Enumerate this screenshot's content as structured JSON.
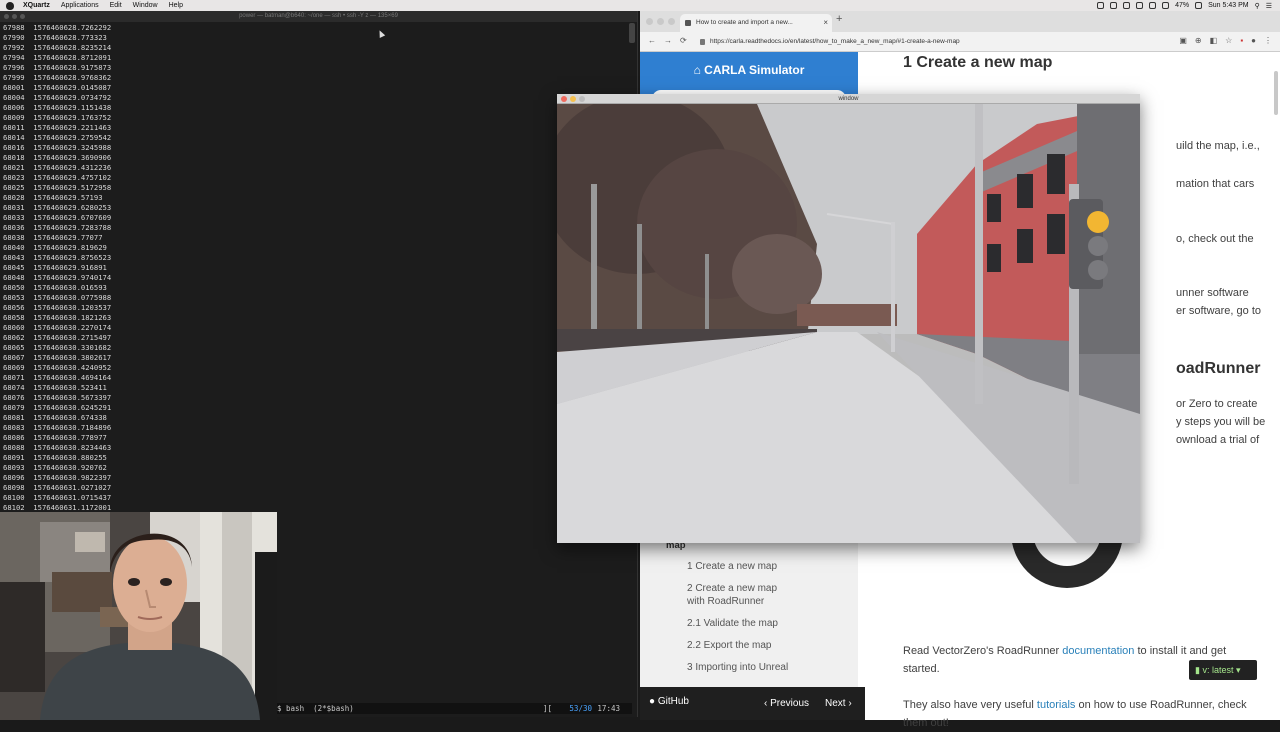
{
  "menubar": {
    "app": "XQuartz",
    "items": [
      "Applications",
      "Edit",
      "Window",
      "Help"
    ],
    "battery": "47%",
    "clock": "Sun 5:43 PM"
  },
  "terminal": {
    "title": "power — batman@b640: ~/one — ssh • ssh -Y z — 135×69",
    "lines": [
      "67988  1576460628.7262292",
      "67990  1576460628.773323",
      "67992  1576460628.8235214",
      "67994  1576460628.8712091",
      "67996  1576460628.9175873",
      "67999  1576460628.9768362",
      "68001  1576460629.0145087",
      "68004  1576460629.0734792",
      "68006  1576460629.1151438",
      "68009  1576460629.1763752",
      "68011  1576460629.2211463",
      "68014  1576460629.2759542",
      "68016  1576460629.3245988",
      "68018  1576460629.3690906",
      "68021  1576460629.4312236",
      "68023  1576460629.4757102",
      "68025  1576460629.5172958",
      "68028  1576460629.57193",
      "68031  1576460629.6280253",
      "68033  1576460629.6707609",
      "68036  1576460629.7283788",
      "68038  1576460629.77077",
      "68040  1576460629.819629",
      "68043  1576460629.8756523",
      "68045  1576460629.916891",
      "68048  1576460629.9740174",
      "68050  1576460630.016593",
      "68053  1576460630.0775988",
      "68056  1576460630.1203537",
      "68058  1576460630.1821263",
      "68060  1576460630.2270174",
      "68062  1576460630.2715497",
      "68065  1576460630.3301682",
      "68067  1576460630.3802617",
      "68069  1576460630.4240952",
      "68071  1576460630.4694164",
      "68074  1576460630.523411",
      "68076  1576460630.5673397",
      "68079  1576460630.6245291",
      "68081  1576460630.674338",
      "68083  1576460630.7184896",
      "68086  1576460630.778977",
      "68088  1576460630.8234463",
      "68091  1576460630.880255",
      "68093  1576460630.920762",
      "68096  1576460630.9822397",
      "68098  1576460631.0271027",
      "68100  1576460631.0715437",
      "68102  1576460631.1172001"
    ],
    "status_left": "$ bash  (2*$bash)",
    "status_bracket": "][",
    "status_pct": "53/30",
    "status_time": "17:43"
  },
  "browser": {
    "tab_title": "How to create and import a new...",
    "url": "https://carla.readthedocs.io/en/latest/how_to_make_a_new_map/#1-create-a-new-map",
    "sidebar": {
      "brand": "CARLA Simulator",
      "section": "map",
      "toc": [
        "1 Create a new map",
        "2 Create a new map with RoadRunner",
        "2.1 Validate the map",
        "2.2 Export the map",
        "3 Importing into Unreal"
      ],
      "github": "GitHub",
      "previous": "Previous",
      "next": "Next"
    },
    "content": {
      "heading": "1 Create a new map",
      "fragments": [
        "uild the map, i.e.,",
        "mation that cars",
        "o, check out the",
        "unner software",
        "er software, go to",
        "or Zero to create",
        "y steps you will be",
        "ownload a trial of"
      ],
      "heading2_fragment": "oadRunner",
      "para1_pre": "Read VectorZero's RoadRunner ",
      "para1_link": "documentation",
      "para1_post": " to install it and get started.",
      "para2_pre": "They also have very useful ",
      "para2_link": "tutorials",
      "para2_post": " on how to use RoadRunner, check them out!"
    },
    "version_badge": "v: latest"
  },
  "carla_window": {
    "title": "window"
  },
  "colors": {
    "rtd_blue": "#2f7fd1",
    "link": "#2980b9",
    "traffic_light_amber": "#f2b632"
  }
}
